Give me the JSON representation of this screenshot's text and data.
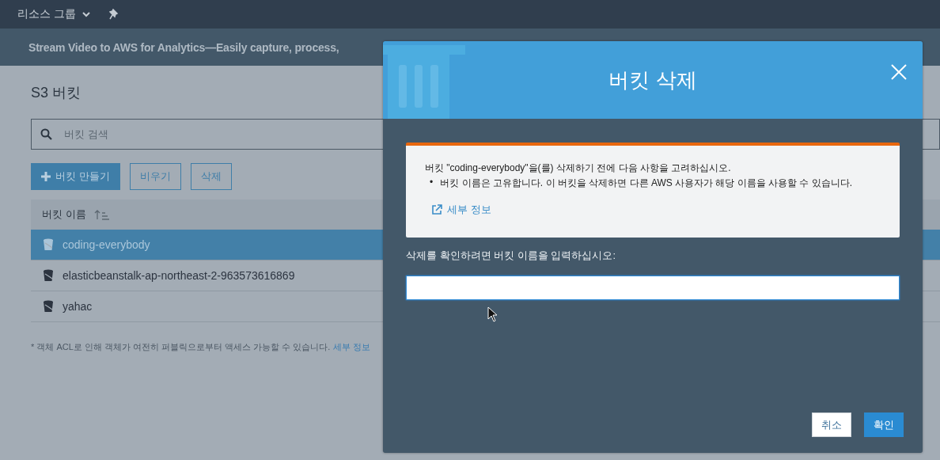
{
  "top_nav": {
    "resource_groups": "리소스 그룹"
  },
  "banner": {
    "text": "Stream Video to AWS for Analytics—Easily capture, process,"
  },
  "page": {
    "title": "S3 버킷",
    "search": {
      "placeholder": "버킷 검색"
    },
    "actions": [
      {
        "label": "버킷 만들기",
        "kind": "primary"
      },
      {
        "label": "비우기",
        "kind": "secondary"
      },
      {
        "label": "삭제",
        "kind": "secondary"
      }
    ],
    "table": {
      "columns": [
        {
          "label": "버킷 이름"
        }
      ],
      "rows": [
        {
          "name": "coding-everybody",
          "selected": true
        },
        {
          "name": "elasticbeanstalk-ap-northeast-2-963573616869",
          "selected": false
        },
        {
          "name": "yahac",
          "selected": false
        }
      ]
    },
    "footnote": {
      "text": "* 객체 ACL로 인해 객체가 여전히 퍼블릭으로부터 액세스 가능할 수 있습니다.",
      "link": "세부 정보"
    }
  },
  "dialog": {
    "title": "버킷 삭제",
    "warning": {
      "message": "버킷 \"coding-everybody\"을(를) 삭제하기 전에 다음 사항을 고려하십시오.",
      "bullets": [
        {
          "marker": "•",
          "text": "버킷 이름은 고유합니다. 이 버킷을 삭제하면 다른 AWS 사용자가 해당 이름을 사용할 수 있습니다."
        }
      ],
      "link": "세부 정보"
    },
    "confirm_label": "삭제를 확인하려면 버킷 이름을 입력하십시오:",
    "buttons": [
      {
        "label": "취소",
        "kind": "secondary"
      },
      {
        "label": "확인",
        "kind": "primary"
      }
    ]
  }
}
